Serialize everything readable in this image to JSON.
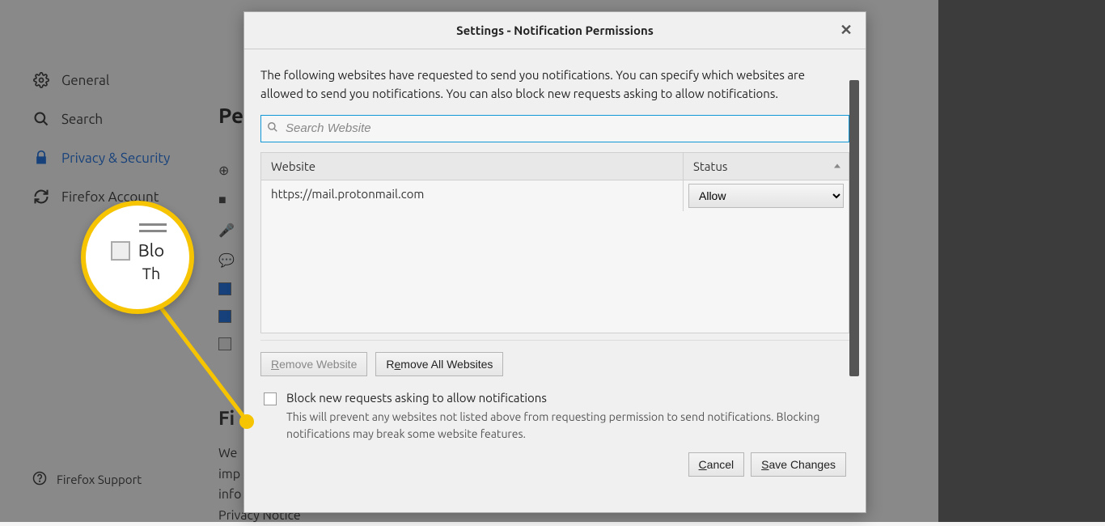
{
  "sidebar": {
    "items": [
      {
        "label": "General",
        "icon": "gear"
      },
      {
        "label": "Search",
        "icon": "search"
      },
      {
        "label": "Privacy & Security",
        "icon": "lock",
        "active": true
      },
      {
        "label": "Firefox Account",
        "icon": "sync"
      }
    ],
    "support": "Firefox Support"
  },
  "main": {
    "heading": "Pe",
    "heading2": "Fi",
    "body1": "We",
    "body2": "imp",
    "body3": "info",
    "link": "Privacy Notice"
  },
  "dialog": {
    "title": "Settings - Notification Permissions",
    "description": "The following websites have requested to send you notifications. You can specify which websites are allowed to send you notifications. You can also block new requests asking to allow notifications.",
    "search_placeholder": "Search Website",
    "columns": {
      "website": "Website",
      "status": "Status"
    },
    "rows": [
      {
        "website": "https://mail.protonmail.com",
        "status": "Allow"
      }
    ],
    "remove_website": "Remove Website",
    "remove_all": "Remove All Websites",
    "block_label": "Block new requests asking to allow notifications",
    "block_help": "This will prevent any websites not listed above from requesting permission to send notifications. Blocking notifications may break some website features.",
    "cancel": "Cancel",
    "save": "Save Changes"
  },
  "magnifier": {
    "text1": "Blo",
    "text2": "Th"
  }
}
